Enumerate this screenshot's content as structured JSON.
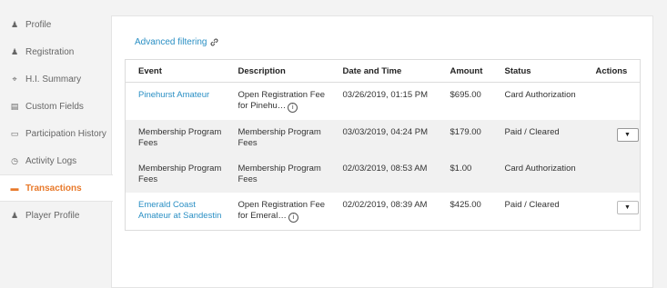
{
  "sidebar": {
    "items": [
      {
        "label": "Profile",
        "icon": "person-icon",
        "glyph": "♟"
      },
      {
        "label": "Registration",
        "icon": "person-badge-icon",
        "glyph": "♟"
      },
      {
        "label": "H.I. Summary",
        "icon": "pin-icon",
        "glyph": "⌖"
      },
      {
        "label": "Custom Fields",
        "icon": "form-icon",
        "glyph": "▤"
      },
      {
        "label": "Participation History",
        "icon": "calendar-icon",
        "glyph": "▭"
      },
      {
        "label": "Activity Logs",
        "icon": "clock-icon",
        "glyph": "◷"
      },
      {
        "label": "Transactions",
        "icon": "card-icon",
        "glyph": "▬"
      },
      {
        "label": "Player Profile",
        "icon": "players-icon",
        "glyph": "♟"
      }
    ],
    "active_index": 6
  },
  "main": {
    "advanced_filtering": "Advanced filtering"
  },
  "table": {
    "headers": {
      "event": "Event",
      "description": "Description",
      "datetime": "Date and Time",
      "amount": "Amount",
      "status": "Status",
      "actions": "Actions"
    },
    "rows": [
      {
        "event": "Pinehurst Amateur",
        "event_link": true,
        "description": "Open Registration Fee for Pinehu…",
        "has_info": true,
        "datetime": "03/26/2019, 01:15 PM",
        "amount": "$695.00",
        "status": "Card Authorization",
        "has_action": false
      },
      {
        "event": "Membership Program Fees",
        "event_link": false,
        "description": "Membership Program Fees",
        "has_info": false,
        "datetime": "03/03/2019, 04:24 PM",
        "amount": "$179.00",
        "status": "Paid / Cleared",
        "has_action": true
      },
      {
        "event": "Membership Program Fees",
        "event_link": false,
        "description": "Membership Program Fees",
        "has_info": false,
        "datetime": "02/03/2019, 08:53 AM",
        "amount": "$1.00",
        "status": "Card Authorization",
        "has_action": false
      },
      {
        "event": "Emerald Coast Amateur at Sandestin",
        "event_link": true,
        "description": "Open Registration Fee for Emeral…",
        "has_info": true,
        "datetime": "02/02/2019, 08:39 AM",
        "amount": "$425.00",
        "status": "Paid / Cleared",
        "has_action": true
      }
    ]
  },
  "colors": {
    "accent": "#e8792a",
    "link": "#2a8fc4"
  }
}
